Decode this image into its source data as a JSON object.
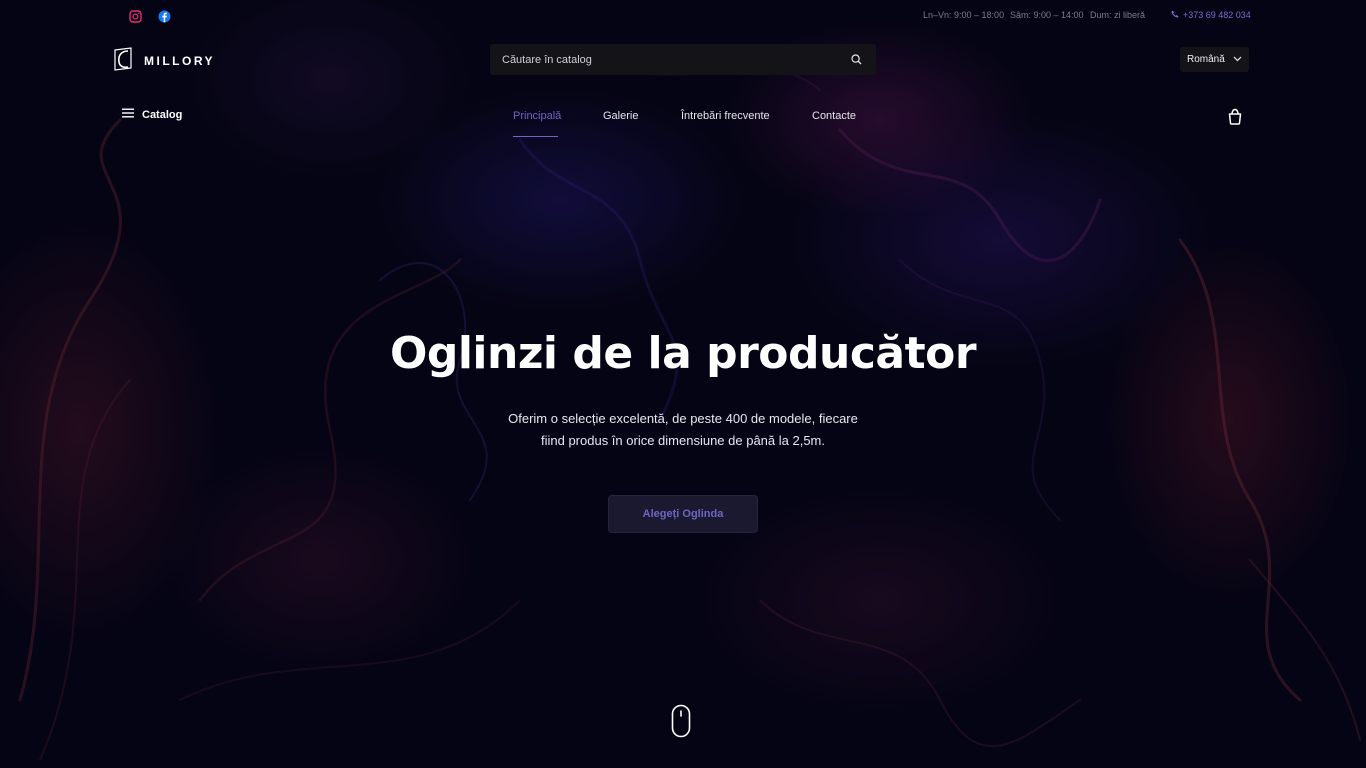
{
  "topbar": {
    "social": [
      {
        "name": "instagram-icon",
        "color": "#e1306c"
      },
      {
        "name": "facebook-icon",
        "color": "#1877f2"
      }
    ],
    "hours": [
      "Ln–Vn: 9:00 – 18:00",
      "Sâm: 9:00 – 14:00",
      "Dum: zi liberă"
    ],
    "phone": "+373 69 482 034",
    "phone_icon": "phone-icon"
  },
  "header": {
    "logo_text": "MILLORY",
    "search": {
      "placeholder": "Căutare în catalog",
      "value": "",
      "icon": "search-icon"
    },
    "language": {
      "selected": "Română",
      "icon": "chevron-down-icon"
    }
  },
  "nav": {
    "catalog_label": "Catalog",
    "catalog_icon": "menu-icon",
    "items": [
      {
        "label": "Principală",
        "active": true
      },
      {
        "label": "Galerie",
        "active": false
      },
      {
        "label": "Întrebări frecvente",
        "active": false
      },
      {
        "label": "Contacte",
        "active": false
      }
    ],
    "cart_icon": "cart-icon"
  },
  "hero": {
    "title": "Oglinzi de la producător",
    "subtitle_line1": "Oferim o selecție excelentă, de peste 400 de modele, fiecare",
    "subtitle_line2": "fiind produs în orice dimensiune de până la 2,5m.",
    "cta_label": "Alegeți Oglinda",
    "scroll_icon": "mouse-scroll-icon"
  },
  "colors": {
    "accent": "#6e66c4",
    "background": "#07061a",
    "button_bg": "#1a1930"
  }
}
